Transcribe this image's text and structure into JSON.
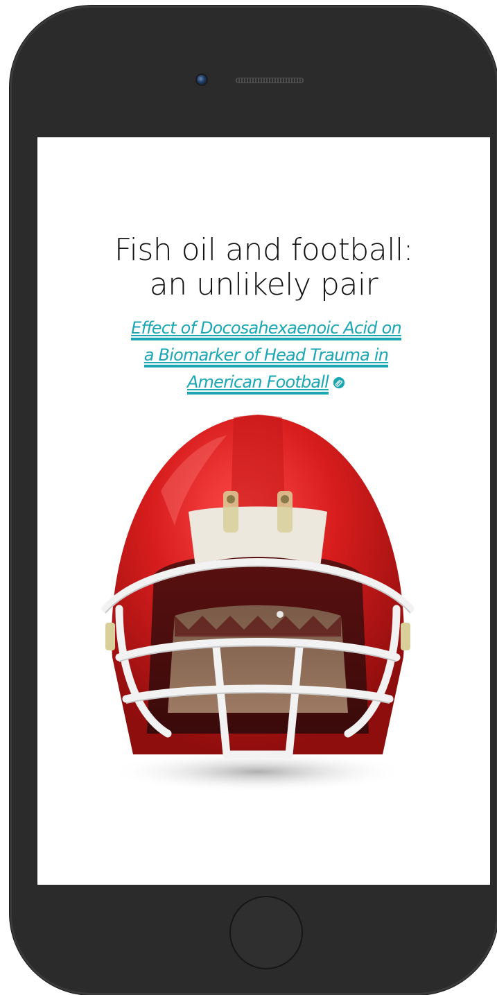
{
  "device": {
    "type": "smartphone",
    "frame_color": "#2b2b2b"
  },
  "screen": {
    "title_line_1": "Fish oil and football:",
    "title_line_2": "an unlikely pair",
    "link": {
      "line_1": "Effect of Docosahexaenoic Acid on",
      "line_2": "a Biomarker of Head Trauma in",
      "line_3": "American Football",
      "color": "#1aa7b3",
      "icon": "paperclip-icon"
    },
    "image": {
      "subject": "red-football-helmet",
      "shell_color": "#d81d1d",
      "facemask_color": "#f2f2f2"
    }
  }
}
